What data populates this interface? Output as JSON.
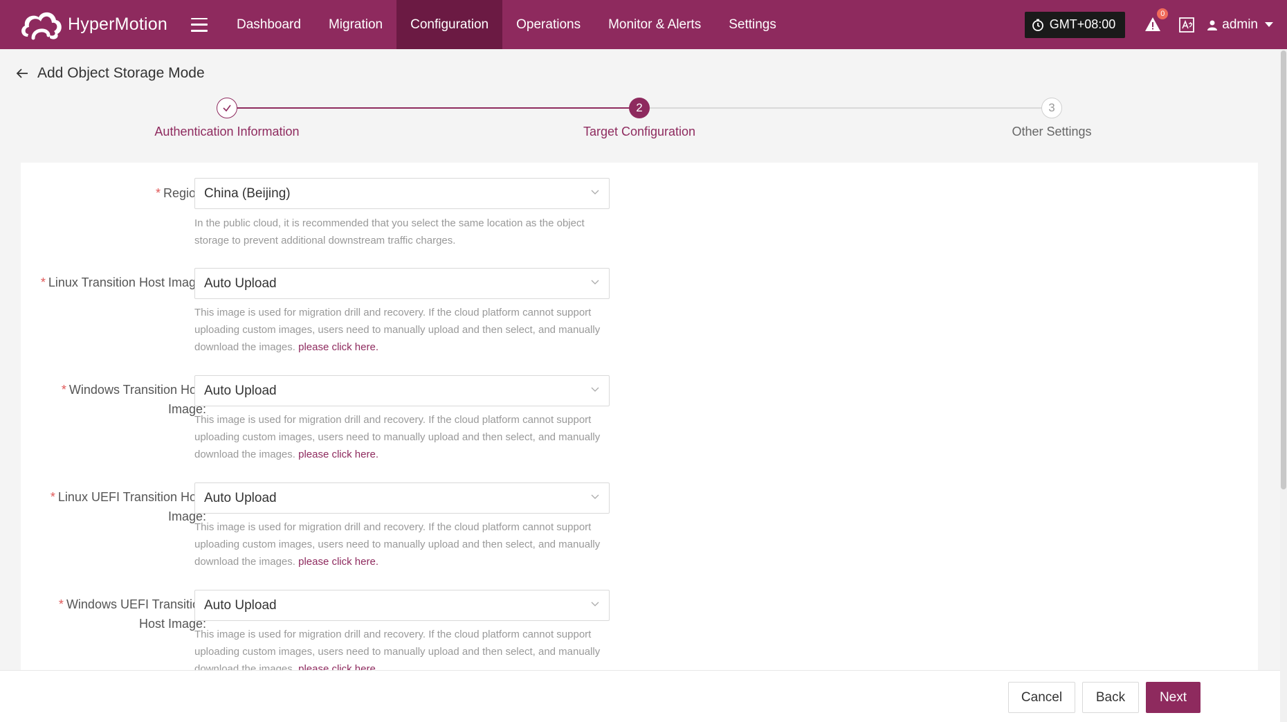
{
  "app": {
    "name": "HyperMotion"
  },
  "nav": {
    "items": [
      {
        "label": "Dashboard",
        "active": false
      },
      {
        "label": "Migration",
        "active": false
      },
      {
        "label": "Configuration",
        "active": true
      },
      {
        "label": "Operations",
        "active": false
      },
      {
        "label": "Monitor & Alerts",
        "active": false
      },
      {
        "label": "Settings",
        "active": false
      }
    ]
  },
  "header_right": {
    "timezone": "GMT+08:00",
    "alert_count": "0",
    "user": "admin"
  },
  "page": {
    "title": "Add Object Storage Mode"
  },
  "steps": [
    {
      "number": "1",
      "label": "Authentication Information",
      "status": "done"
    },
    {
      "number": "2",
      "label": "Target Configuration",
      "status": "active"
    },
    {
      "number": "3",
      "label": "Other Settings",
      "status": "pending"
    }
  ],
  "form": {
    "region": {
      "label": "Region:",
      "value": "China (Beijing)",
      "help": "In the public cloud, it is recommended that you select the same location as the object storage to prevent additional downstream traffic charges."
    },
    "fields": [
      {
        "label": "Linux Transition Host Image:",
        "value": "Auto Upload",
        "help": "This image is used for migration drill and recovery. If the cloud platform cannot support uploading custom images, users need to manually upload and then select, and manually download the images.",
        "link": "please click here."
      },
      {
        "label": "Windows Transition Host Image:",
        "value": "Auto Upload",
        "help": "This image is used for migration drill and recovery. If the cloud platform cannot support uploading custom images, users need to manually upload and then select, and manually download the images.",
        "link": "please click here."
      },
      {
        "label": "Linux UEFI Transition Host Image:",
        "value": "Auto Upload",
        "help": "This image is used for migration drill and recovery. If the cloud platform cannot support uploading custom images, users need to manually upload and then select, and manually download the images.",
        "link": "please click here."
      },
      {
        "label": "Windows UEFI Transition Host Image:",
        "value": "Auto Upload",
        "help": "This image is used for migration drill and recovery. If the cloud platform cannot support uploading custom images, users need to manually upload and then select, and manually download the images.",
        "link": "please click here."
      }
    ]
  },
  "footer": {
    "cancel": "Cancel",
    "back": "Back",
    "next": "Next"
  },
  "colors": {
    "brand": "#8e2a5e",
    "nav_active": "#6b1a43",
    "required": "#e05858"
  }
}
